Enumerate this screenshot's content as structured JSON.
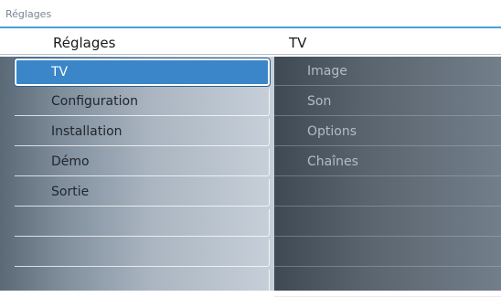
{
  "breadcrumb": "Réglages",
  "accent": "#4a9fd6",
  "left_column": {
    "title": "Réglages",
    "selected_index": 0,
    "items": [
      {
        "label": "TV"
      },
      {
        "label": "Configuration"
      },
      {
        "label": "Installation"
      },
      {
        "label": "Démo"
      },
      {
        "label": "Sortie"
      },
      {
        "label": ""
      },
      {
        "label": ""
      },
      {
        "label": ""
      }
    ]
  },
  "right_column": {
    "title": "TV",
    "items": [
      {
        "label": "Image"
      },
      {
        "label": "Son"
      },
      {
        "label": "Options"
      },
      {
        "label": "Chaînes"
      },
      {
        "label": ""
      },
      {
        "label": ""
      },
      {
        "label": ""
      },
      {
        "label": ""
      }
    ]
  }
}
